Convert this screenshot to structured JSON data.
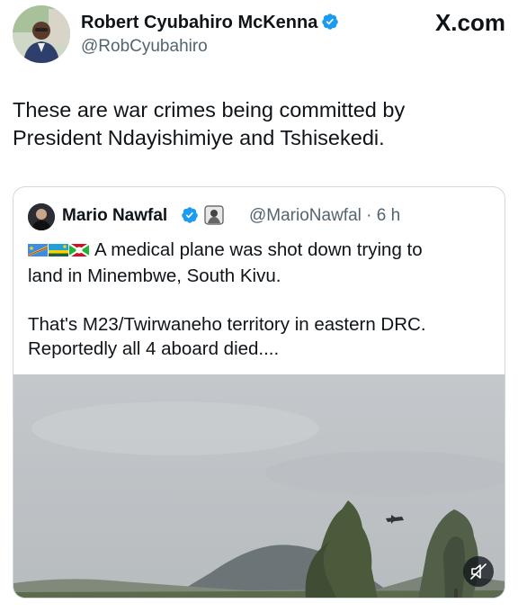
{
  "post": {
    "author_name": "Robert Cyubahiro McKenna",
    "author_handle": "@RobCyubahiro",
    "source_brand": "X.com",
    "text_line1": "These are war crimes being committed by",
    "text_line2": "President Ndayishimiye and Tshisekedi."
  },
  "quoted_post": {
    "author_name": "Mario Nawfal",
    "author_handle": "@MarioNawfal",
    "separator": "·",
    "time": "6 h",
    "flags": [
      "DR Congo flag",
      "Rwanda flag",
      "Burundi flag"
    ],
    "line1": "A medical plane was shot down trying to",
    "line2": "land in Minembwe, South Kivu.",
    "line3": "That's M23/Twirwaneho territory in eastern DRC.",
    "line4": "Reportedly all 4 aboard died...."
  },
  "media": {
    "type": "video",
    "mute_icon": "muted-speaker-icon"
  },
  "colors": {
    "verified_blue": "#1d9bf0",
    "text_primary": "#0f1419",
    "text_secondary": "#536471",
    "border": "#cfd9de"
  }
}
